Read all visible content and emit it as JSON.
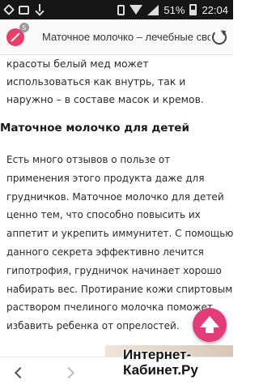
{
  "status_bar": {
    "battery": "51%",
    "time": "22:04"
  },
  "browser": {
    "tab_count": "5",
    "page_title": "Маточное молочко – лечебные свойства"
  },
  "article": {
    "para_top": "красоты белый мед может использоваться как внутрь, так и наружно – в составе масок и кремов.",
    "heading": "Маточное молочко для детей",
    "para_main": "Есть много отзывов о пользе от применения этого продукта даже для грудничков. Маточное молочко для детей ценно тем, что способно повысить их аппетит и укрепить иммунитет. С помощью данного секрета эффективно лечится гипотрофия, грудничок начинает хорошо набирать вес. Протирание кожи спиртовым раствором пчелиного молочка поможет избавить ребенка от опрелостей."
  },
  "watermark": {
    "line1": "Интернет-",
    "line2": "Кабинет.Ру"
  },
  "colors": {
    "accent": "#e23d78",
    "status_bar_bg": "#161616"
  }
}
